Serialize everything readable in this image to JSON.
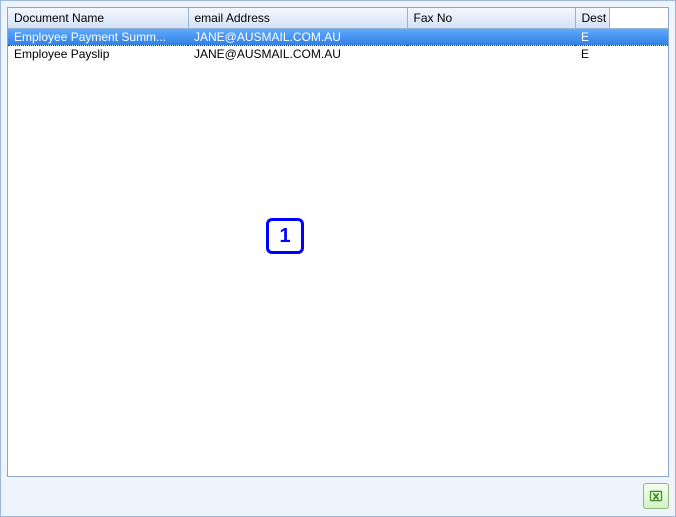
{
  "table": {
    "columns": [
      {
        "key": "doc",
        "label": "Document Name"
      },
      {
        "key": "email",
        "label": "email Address"
      },
      {
        "key": "fax",
        "label": "Fax No"
      },
      {
        "key": "dest",
        "label": "Dest"
      }
    ],
    "rows": [
      {
        "doc": "Employee Payment Summ...",
        "email": "JANE@AUSMAIL.COM.AU",
        "fax": "",
        "dest": "E",
        "selected": true
      },
      {
        "doc": "Employee Payslip",
        "email": "JANE@AUSMAIL.COM.AU",
        "fax": "",
        "dest": "E",
        "selected": false
      }
    ]
  },
  "annotation": {
    "label": "1"
  },
  "buttons": {
    "export_name": "export-excel-icon"
  }
}
